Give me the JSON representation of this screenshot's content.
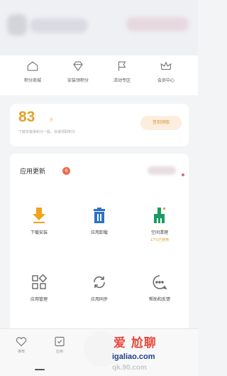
{
  "quick_actions": [
    {
      "label": "积分商城",
      "icon": "home-icon"
    },
    {
      "label": "安装领积分",
      "icon": "diamond-icon"
    },
    {
      "label": "活动专区",
      "icon": "flag-icon"
    },
    {
      "label": "会员中心",
      "icon": "crown-icon"
    }
  ],
  "points": {
    "value": "83",
    "unit": "分",
    "description": "下载安装得积分一般，快速领取积分",
    "button_label": "签到领取"
  },
  "apps": {
    "title": "应用更新",
    "badge": "6",
    "tiles": [
      {
        "label": "下载安装",
        "icon": "download-icon"
      },
      {
        "label": "应用卸载",
        "icon": "trash-icon"
      },
      {
        "label": "空间清理",
        "icon": "broom-icon",
        "sub": "17%已使用"
      },
      {
        "label": "应用管理",
        "icon": "grid-icon"
      },
      {
        "label": "应用同步",
        "icon": "sync-icon"
      },
      {
        "label": "帮助和反馈",
        "icon": "chat-icon"
      }
    ]
  },
  "bottom_nav": [
    {
      "label": "推荐",
      "icon": "heart-icon"
    },
    {
      "label": "应用",
      "icon": "check-box-icon"
    }
  ],
  "watermark": {
    "text": "爱 尬聊",
    "url": "igaliao.com",
    "url2": "qk.90.com"
  },
  "colors": {
    "accent_orange": "#e2a32a",
    "badge_red": "#ee6b4d",
    "download_orange": "#f2a21b",
    "trash_blue": "#2a72c8",
    "broom_green": "#1a9b62",
    "watermark_red": "#e6463a",
    "watermark_blue": "#1f3f88"
  }
}
